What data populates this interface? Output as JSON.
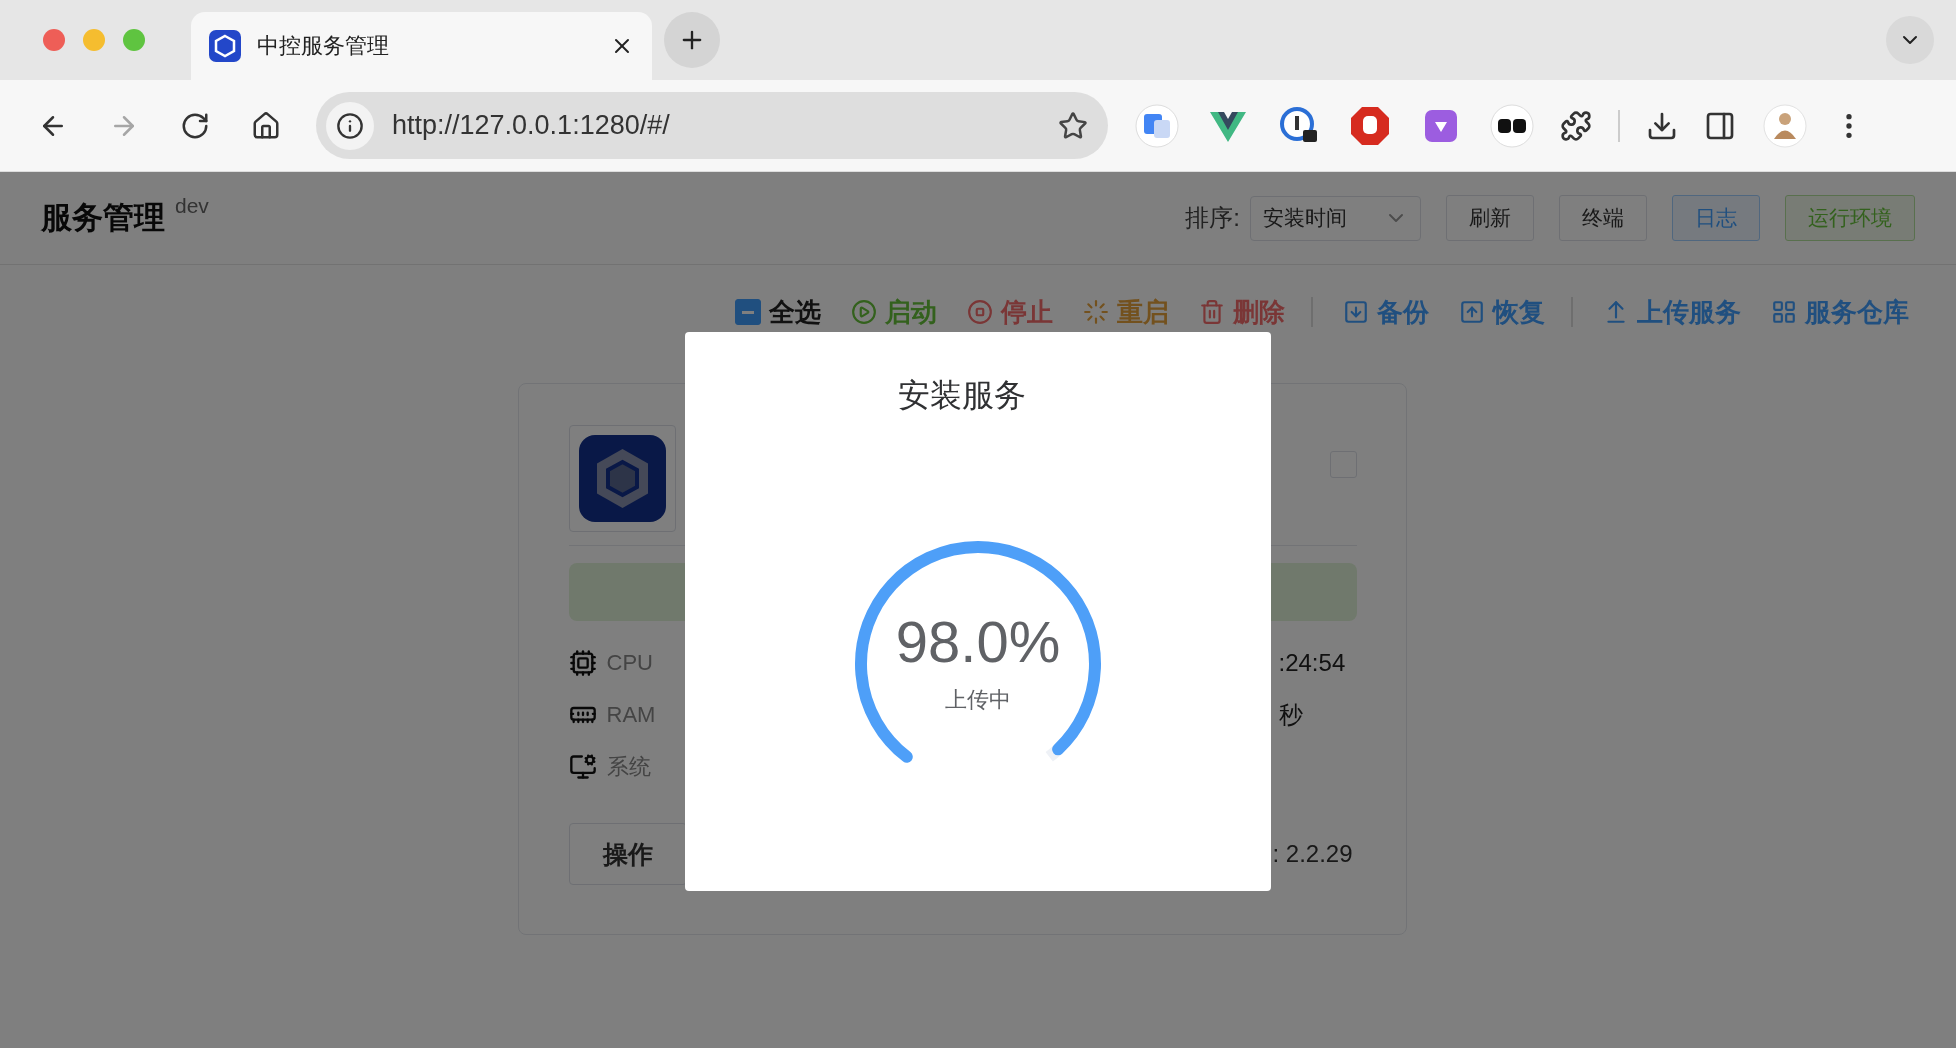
{
  "browser": {
    "tab": {
      "title": "中控服务管理",
      "selected": true
    },
    "nav": [
      {
        "kind": "back",
        "disabled": false
      },
      {
        "kind": "forward",
        "disabled": true
      },
      {
        "kind": "reload",
        "disabled": false
      },
      {
        "kind": "home",
        "disabled": false
      }
    ],
    "address": {
      "url": "http://127.0.0.1:1280/#/"
    }
  },
  "header": {
    "title": "服务管理",
    "badge": "dev",
    "sort": {
      "label": "排序:",
      "value": "安装时间"
    },
    "buttons": [
      {
        "label": "刷新",
        "kind": "default"
      },
      {
        "label": "终端",
        "kind": "default"
      },
      {
        "label": "日志",
        "kind": "primary"
      },
      {
        "label": "运行环境",
        "kind": "success"
      }
    ]
  },
  "toolbar": {
    "select_all": {
      "label": "全选",
      "indeterminate": true
    },
    "groups": [
      [
        {
          "label": "启动",
          "kind": "start"
        },
        {
          "label": "停止",
          "kind": "stop"
        },
        {
          "label": "重启",
          "kind": "restart"
        },
        {
          "label": "删除",
          "kind": "delete"
        }
      ],
      [
        {
          "label": "备份",
          "kind": "backup"
        },
        {
          "label": "恢复",
          "kind": "restore"
        }
      ],
      [
        {
          "label": "上传服务",
          "kind": "upload"
        },
        {
          "label": "服务仓库",
          "kind": "store"
        }
      ]
    ]
  },
  "card": {
    "checked": false,
    "rows": [
      {
        "kind": "cpu",
        "label": "CPU",
        "value": ":24:54"
      },
      {
        "kind": "ram",
        "label": "RAM",
        "value": "秒"
      },
      {
        "kind": "system",
        "label": "系统"
      }
    ],
    "button": "操作",
    "version": ": 2.2.29"
  },
  "dialog": {
    "title": "安装服务",
    "progress": {
      "level": 0.98,
      "reading": "98.0%",
      "status": "上传中"
    }
  }
}
